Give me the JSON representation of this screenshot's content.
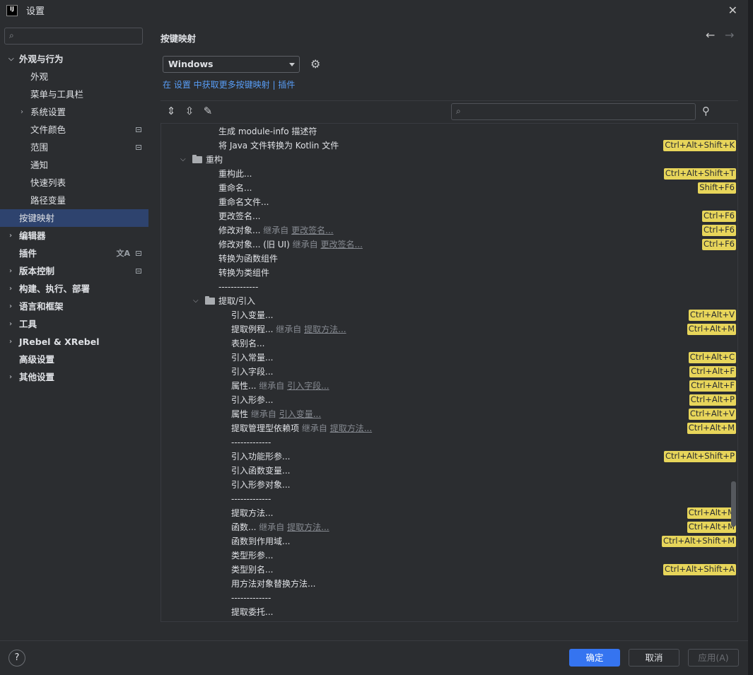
{
  "window": {
    "title": "设置",
    "logo": "IJ"
  },
  "sidebar": {
    "search_placeholder": "",
    "items": [
      {
        "label": "外观与行为",
        "expanded": true
      },
      {
        "label": "外观"
      },
      {
        "label": "菜单与工具栏"
      },
      {
        "label": "系统设置"
      },
      {
        "label": "文件颜色"
      },
      {
        "label": "范围"
      },
      {
        "label": "通知"
      },
      {
        "label": "快速列表"
      },
      {
        "label": "路径变量"
      },
      {
        "label": "按键映射",
        "selected": true
      },
      {
        "label": "编辑器"
      },
      {
        "label": "插件"
      },
      {
        "label": "版本控制"
      },
      {
        "label": "构建、执行、部署"
      },
      {
        "label": "语言和框架"
      },
      {
        "label": "工具"
      },
      {
        "label": "JRebel & XRebel"
      },
      {
        "label": "高级设置"
      },
      {
        "label": "其他设置"
      }
    ]
  },
  "main": {
    "heading": "按键映射",
    "scheme": "Windows",
    "links": {
      "prefix": "在 ",
      "settings": "设置",
      "middle": " 中获取更多按键映射 | ",
      "plugins": "插件"
    },
    "search_placeholder": ""
  },
  "actions": [
    {
      "label": "生成 module-info 描述符"
    },
    {
      "label": "将 Java 文件转换为 Kotlin 文件",
      "shortcut": "Ctrl+Alt+Shift+K"
    },
    {
      "label": "重构"
    },
    {
      "label": "重构此...",
      "shortcut": "Ctrl+Alt+Shift+T"
    },
    {
      "label": "重命名...",
      "shortcut": "Shift+F6"
    },
    {
      "label": "重命名文件..."
    },
    {
      "label": "更改签名...",
      "shortcut": "Ctrl+F6"
    },
    {
      "label": "修改对象...",
      "inherit": "继承自",
      "inherit_from": "更改签名...",
      "shortcut": "Ctrl+F6"
    },
    {
      "label": "修改对象... (旧 UI)",
      "inherit": "继承自",
      "inherit_from": "更改签名...",
      "shortcut": "Ctrl+F6"
    },
    {
      "label": "转换为函数组件"
    },
    {
      "label": "转换为类组件"
    },
    {
      "label": "-------------"
    },
    {
      "label": "提取/引入"
    },
    {
      "label": "引入变量...",
      "shortcut": "Ctrl+Alt+V"
    },
    {
      "label": "提取例程...",
      "inherit": "继承自",
      "inherit_from": "提取方法...",
      "shortcut": "Ctrl+Alt+M"
    },
    {
      "label": "表别名..."
    },
    {
      "label": "引入常量...",
      "shortcut": "Ctrl+Alt+C"
    },
    {
      "label": "引入字段...",
      "shortcut": "Ctrl+Alt+F"
    },
    {
      "label": "属性...",
      "inherit": "继承自",
      "inherit_from": "引入字段...",
      "shortcut": "Ctrl+Alt+F"
    },
    {
      "label": "引入形参...",
      "shortcut": "Ctrl+Alt+P"
    },
    {
      "label": "属性",
      "inherit": "继承自",
      "inherit_from": "引入变量...",
      "shortcut": "Ctrl+Alt+V"
    },
    {
      "label": "提取管理型依赖项",
      "inherit": "继承自",
      "inherit_from": "提取方法...",
      "shortcut": "Ctrl+Alt+M"
    },
    {
      "label": "-------------"
    },
    {
      "label": "引入功能形参...",
      "shortcut": "Ctrl+Alt+Shift+P"
    },
    {
      "label": "引入函数变量..."
    },
    {
      "label": "引入形参对象..."
    },
    {
      "label": "-------------"
    },
    {
      "label": "提取方法...",
      "shortcut": "Ctrl+Alt+M"
    },
    {
      "label": "函数...",
      "inherit": "继承自",
      "inherit_from": "提取方法...",
      "shortcut": "Ctrl+Alt+M"
    },
    {
      "label": "函数到作用域...",
      "shortcut": "Ctrl+Alt+Shift+M"
    },
    {
      "label": "类型形参..."
    },
    {
      "label": "类型别名...",
      "shortcut": "Ctrl+Alt+Shift+A"
    },
    {
      "label": "用方法对象替换方法..."
    },
    {
      "label": "-------------"
    },
    {
      "label": "提取委托..."
    }
  ],
  "buttons": {
    "help": "?",
    "ok": "确定",
    "cancel": "取消",
    "apply": "应用(A)"
  },
  "colors": {
    "accent": "#3574f0",
    "shortcut_bg": "#e7d55a",
    "link": "#589df6",
    "selected": "#2e436e"
  }
}
